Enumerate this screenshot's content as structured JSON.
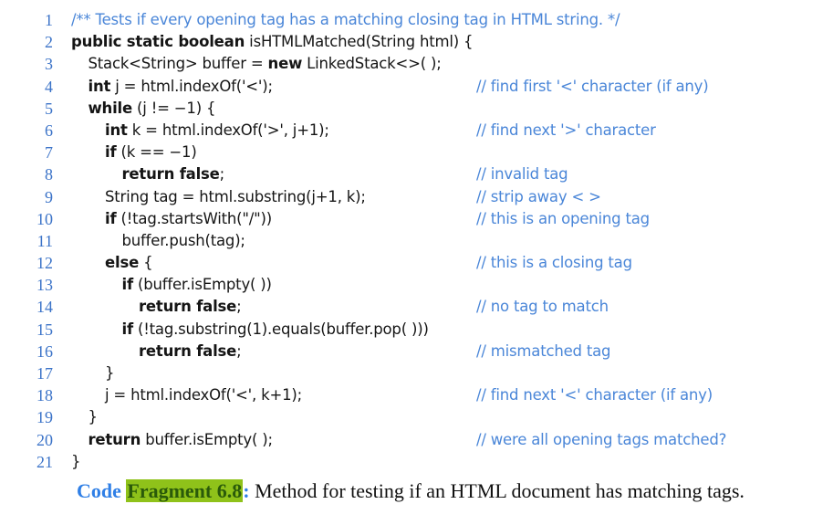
{
  "code_listing": {
    "lines": [
      {
        "number": "1",
        "indent": 0,
        "parts": [
          {
            "t": "/** Tests if every opening tag has a matching closing tag in HTML string. */",
            "k": "doc"
          }
        ],
        "comment": ""
      },
      {
        "number": "2",
        "indent": 0,
        "parts": [
          {
            "t": "public static boolean",
            "k": "kw"
          },
          {
            "t": " isHTMLMatched(String html) {",
            "k": ""
          }
        ],
        "comment": ""
      },
      {
        "number": "3",
        "indent": 1,
        "parts": [
          {
            "t": "Stack<String> buffer = ",
            "k": ""
          },
          {
            "t": "new",
            "k": "kw"
          },
          {
            "t": " LinkedStack<>( );",
            "k": ""
          }
        ],
        "comment": ""
      },
      {
        "number": "4",
        "indent": 1,
        "parts": [
          {
            "t": "int",
            "k": "kw"
          },
          {
            "t": " j = html.indexOf('<');",
            "k": ""
          }
        ],
        "comment": "// find first '<' character (if any)"
      },
      {
        "number": "5",
        "indent": 1,
        "parts": [
          {
            "t": "while",
            "k": "kw"
          },
          {
            "t": " (j != −1) {",
            "k": ""
          }
        ],
        "comment": ""
      },
      {
        "number": "6",
        "indent": 2,
        "parts": [
          {
            "t": "int",
            "k": "kw"
          },
          {
            "t": " k = html.indexOf('>', j+1);",
            "k": ""
          }
        ],
        "comment": "// find next '>' character"
      },
      {
        "number": "7",
        "indent": 2,
        "parts": [
          {
            "t": "if",
            "k": "kw"
          },
          {
            "t": " (k == −1)",
            "k": ""
          }
        ],
        "comment": ""
      },
      {
        "number": "8",
        "indent": 3,
        "parts": [
          {
            "t": "return false",
            "k": "kw"
          },
          {
            "t": ";",
            "k": ""
          }
        ],
        "comment": "// invalid tag"
      },
      {
        "number": "9",
        "indent": 2,
        "parts": [
          {
            "t": "String tag = html.substring(j+1, k);",
            "k": ""
          }
        ],
        "comment": "// strip away < >"
      },
      {
        "number": "10",
        "indent": 2,
        "parts": [
          {
            "t": "if",
            "k": "kw"
          },
          {
            "t": " (!tag.startsWith(\"/\"))",
            "k": ""
          }
        ],
        "comment": "// this is an opening tag"
      },
      {
        "number": "11",
        "indent": 3,
        "parts": [
          {
            "t": "buffer.push(tag);",
            "k": ""
          }
        ],
        "comment": ""
      },
      {
        "number": "12",
        "indent": 2,
        "parts": [
          {
            "t": "else",
            "k": "kw"
          },
          {
            "t": " {",
            "k": ""
          }
        ],
        "comment": "// this is a closing tag"
      },
      {
        "number": "13",
        "indent": 3,
        "parts": [
          {
            "t": "if",
            "k": "kw"
          },
          {
            "t": " (buffer.isEmpty( ))",
            "k": ""
          }
        ],
        "comment": ""
      },
      {
        "number": "14",
        "indent": 4,
        "parts": [
          {
            "t": "return false",
            "k": "kw"
          },
          {
            "t": ";",
            "k": ""
          }
        ],
        "comment": "// no tag to match"
      },
      {
        "number": "15",
        "indent": 3,
        "parts": [
          {
            "t": "if",
            "k": "kw"
          },
          {
            "t": " (!tag.substring(1).equals(buffer.pop( )))",
            "k": ""
          }
        ],
        "comment": ""
      },
      {
        "number": "16",
        "indent": 4,
        "parts": [
          {
            "t": "return false",
            "k": "kw"
          },
          {
            "t": ";",
            "k": ""
          }
        ],
        "comment": "// mismatched tag"
      },
      {
        "number": "17",
        "indent": 2,
        "parts": [
          {
            "t": "}",
            "k": ""
          }
        ],
        "comment": ""
      },
      {
        "number": "18",
        "indent": 2,
        "parts": [
          {
            "t": "j = html.indexOf('<', k+1);",
            "k": ""
          }
        ],
        "comment": "// find next '<' character (if any)"
      },
      {
        "number": "19",
        "indent": 1,
        "parts": [
          {
            "t": "}",
            "k": ""
          }
        ],
        "comment": ""
      },
      {
        "number": "20",
        "indent": 1,
        "parts": [
          {
            "t": "return",
            "k": "kw"
          },
          {
            "t": " buffer.isEmpty( );",
            "k": ""
          }
        ],
        "comment": "// were all opening tags matched?"
      },
      {
        "number": "21",
        "indent": 0,
        "parts": [
          {
            "t": "}",
            "k": ""
          }
        ],
        "comment": ""
      }
    ]
  },
  "caption": {
    "label_code": "Code",
    "label_fragment": "Fragment 6.8",
    "colon": ":",
    "text": " Method for testing if an HTML document has matching tags."
  },
  "colors": {
    "line_numbers": "#3b73c8",
    "comments": "#4a86d8",
    "caption_code": "#2f7fe6",
    "caption_highlight": "#8fc21a",
    "caption_highlight_text": "#2a5a0a"
  }
}
